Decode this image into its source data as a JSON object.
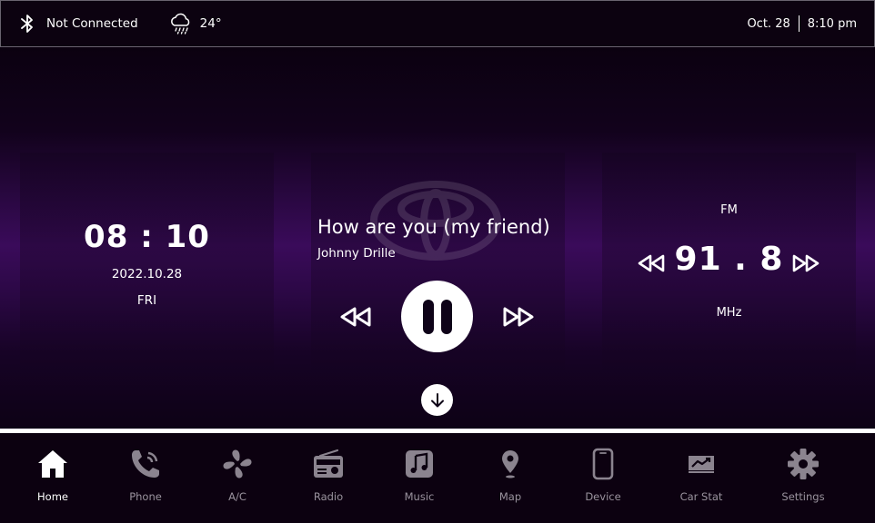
{
  "status": {
    "bluetooth_text": "Not Connected",
    "temperature": "24°",
    "date": "Oct. 28",
    "time": "8:10 pm"
  },
  "clock": {
    "time": "08 : 10",
    "date": "2022.10.28",
    "day": "FRI"
  },
  "music": {
    "title": "How are you (my friend)",
    "artist": "Johnny Drille",
    "state": "playing"
  },
  "radio": {
    "band": "FM",
    "frequency": "91 . 8",
    "unit": "MHz"
  },
  "nav": {
    "items": [
      {
        "label": "Home",
        "icon": "home-icon",
        "active": true
      },
      {
        "label": "Phone",
        "icon": "phone-icon"
      },
      {
        "label": "A/C",
        "icon": "fan-icon"
      },
      {
        "label": "Radio",
        "icon": "radio-icon"
      },
      {
        "label": "Music",
        "icon": "music-icon"
      },
      {
        "label": "Map",
        "icon": "map-pin-icon"
      },
      {
        "label": "Device",
        "icon": "device-icon"
      },
      {
        "label": "Car Stat",
        "icon": "car-stat-icon"
      },
      {
        "label": "Settings",
        "icon": "gear-icon"
      }
    ]
  },
  "colors": {
    "accent": "#3a0b5a",
    "inactive_icon": "#8b848f",
    "active_icon": "#ffffff"
  }
}
